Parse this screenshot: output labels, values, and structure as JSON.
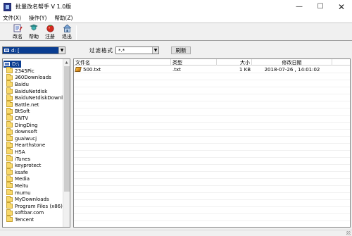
{
  "window": {
    "title": "批量改名帮手  V 1.0版",
    "icon": "app-icon",
    "controls": {
      "minimize": "—",
      "maximize": "☐",
      "close": "✕"
    }
  },
  "menu": [
    "文件(X)",
    "操作(Y)",
    "帮助(Z)"
  ],
  "toolbar": {
    "buttons": [
      {
        "label": "改名",
        "icon": "rename-icon"
      },
      {
        "label": "帮助",
        "icon": "help-icon"
      },
      {
        "label": "注册",
        "icon": "register-icon"
      },
      {
        "label": "退出",
        "icon": "exit-icon"
      }
    ]
  },
  "drive_select": {
    "value": "d: [",
    "icon": "drive-icon"
  },
  "filter": {
    "label": "过滤格式",
    "value": "*.*"
  },
  "refresh_label": "刷新",
  "tree": {
    "root": "D:\\",
    "folders": [
      "2345Pic",
      "360Downloads",
      "Baidu",
      "BaiduNetdisk",
      "BaiduNetdiskDownload",
      "Battle.net",
      "BtSoft",
      "CNTV",
      "DingDing",
      "downsoft",
      "guaiwucj",
      "Hearthstone",
      "HSA",
      "iTunes",
      "keyprotect",
      "ksafe",
      "Media",
      "Meitu",
      "mumu",
      "MyDownloads",
      "Program Files (x86)",
      "softbar.com",
      "Tencent"
    ]
  },
  "file_list": {
    "columns": [
      "文件名",
      "类型",
      "大小",
      "修改日期"
    ],
    "rows": [
      {
        "name": "500.txt",
        "type": ".txt",
        "size": "1 KB",
        "modified": "2018-07-26 , 14:01:02"
      }
    ]
  },
  "colors": {
    "selection": "#0a3d91",
    "folder": "#f8d86a",
    "window_bg": "#f0f0f0"
  }
}
